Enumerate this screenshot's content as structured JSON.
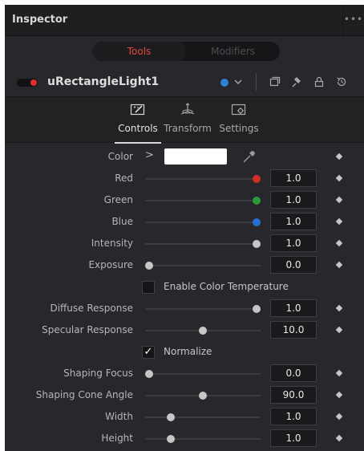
{
  "inspector": {
    "title": "Inspector",
    "more_label": "•••"
  },
  "segment_tabs": [
    {
      "label": "Tools",
      "active": true
    },
    {
      "label": "Modifiers",
      "active": false
    }
  ],
  "tool": {
    "name": "uRectangleLight1",
    "enabled": true,
    "color_tag": "#2f7fd2"
  },
  "panel_tabs": [
    {
      "label": "Controls",
      "icon": "controls-icon",
      "active": true
    },
    {
      "label": "Transform",
      "icon": "transform-icon",
      "active": false
    },
    {
      "label": "Settings",
      "icon": "settings-icon",
      "active": false
    }
  ],
  "controls": {
    "color": {
      "label": "Color",
      "expander": ">",
      "swatch": "#ffffff"
    },
    "red": {
      "label": "Red",
      "value": "1.0",
      "level": 1.0,
      "knob_color": "#d0302c"
    },
    "green": {
      "label": "Green",
      "value": "1.0",
      "level": 1.0,
      "knob_color": "#2d9a3a"
    },
    "blue": {
      "label": "Blue",
      "value": "1.0",
      "level": 1.0,
      "knob_color": "#2a6fcf"
    },
    "intensity": {
      "label": "Intensity",
      "value": "1.0",
      "level": 1.0
    },
    "exposure": {
      "label": "Exposure",
      "value": "0.0",
      "level": 0.0
    },
    "enable_color_temperature": {
      "label": "Enable Color Temperature",
      "checked": false
    },
    "diffuse_response": {
      "label": "Diffuse Response",
      "value": "1.0",
      "level": 1.0
    },
    "specular_response": {
      "label": "Specular Response",
      "value": "10.0",
      "level": 0.5
    },
    "normalize": {
      "label": "Normalize",
      "checked": true,
      "check_glyph": "✓"
    },
    "shaping_focus": {
      "label": "Shaping Focus",
      "value": "0.0",
      "level": 0.0
    },
    "shaping_cone_angle": {
      "label": "Shaping Cone Angle",
      "value": "90.0",
      "level": 0.5
    },
    "width": {
      "label": "Width",
      "value": "1.0",
      "level": 0.2
    },
    "height": {
      "label": "Height",
      "value": "1.0",
      "level": 0.2
    }
  }
}
